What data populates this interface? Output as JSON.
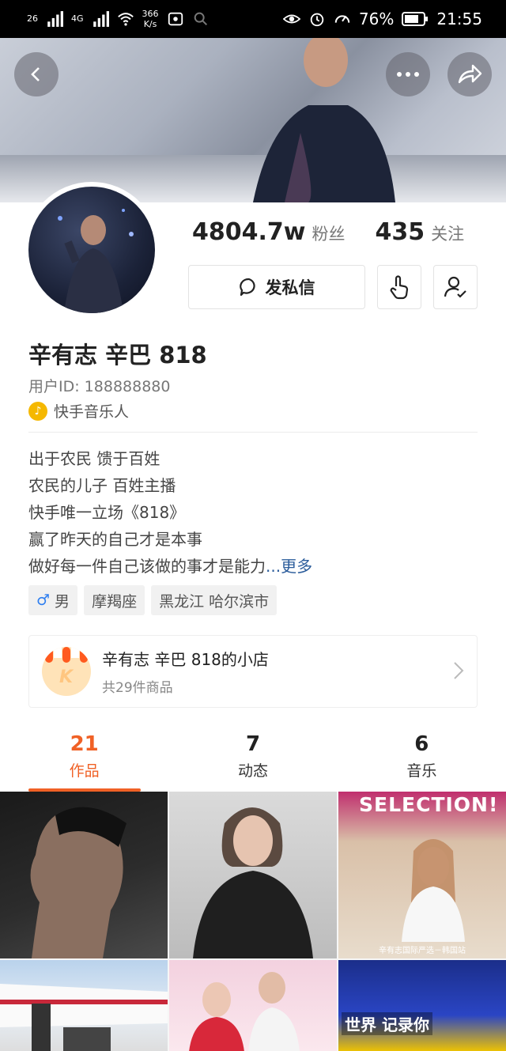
{
  "status_bar": {
    "signal1": "26",
    "signal2": "4G",
    "net_speed": "366",
    "net_unit": "K/s",
    "battery": "76%",
    "time": "21:55"
  },
  "profile": {
    "followers_count": "4804.7w",
    "followers_label": "粉丝",
    "following_count": "435",
    "following_label": "关注",
    "message_button": "发私信",
    "name": "辛有志 辛巴 818",
    "user_id": "用户ID: 188888880",
    "badge": "快手音乐人",
    "bio_lines": [
      "出于农民 馈于百姓",
      "农民的儿子 百姓主播",
      "快手唯一立场《818》",
      "赢了昨天的自己才是本事",
      "做好每一件自己该做的事才是能力"
    ],
    "bio_ellipsis": "...",
    "bio_more": "更多",
    "tags": [
      "男",
      "摩羯座",
      "黑龙江 哈尔滨市"
    ],
    "gender_symbol": "♂"
  },
  "shop": {
    "title": "辛有志 辛巴 818的小店",
    "subtitle": "共29件商品",
    "logo_letter": "K"
  },
  "tabs": [
    {
      "count": "21",
      "label": "作品"
    },
    {
      "count": "7",
      "label": "动态"
    },
    {
      "count": "6",
      "label": "音乐"
    }
  ],
  "thumbs": {
    "selection_text": "SELECTION!",
    "selection_caption": "辛有志国际严选－韩国站",
    "world_text": "世界 记录你"
  },
  "colors": {
    "accent": "#f06126",
    "link": "#2b5c9b",
    "badge": "#f5b800"
  }
}
